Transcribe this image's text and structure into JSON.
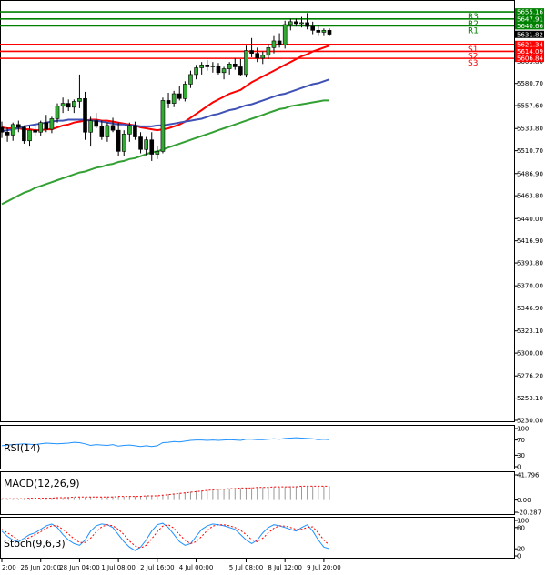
{
  "chart_data": [
    {
      "type": "candlestick",
      "name": "price",
      "ylim": [
        5230,
        5660
      ],
      "y_ticks": [
        "5655.16",
        "5647.91",
        "5640.66",
        "5631.82",
        "5621.34",
        "5614.09",
        "5606.84",
        "5603.80",
        "5580.70",
        "5557.60",
        "5533.80",
        "5510.70",
        "5486.90",
        "5463.80",
        "5440.00",
        "5416.90",
        "5393.80",
        "5370.00",
        "5346.90",
        "5323.10",
        "5300.00",
        "5276.20",
        "5253.10",
        "5230.00"
      ],
      "x_ticks": [
        "2:00",
        "26 Jun 20:00",
        "28 Jun 04:00",
        "1 Jul 08:00",
        "2 Jul 16:00",
        "4 Jul 00:00",
        "5 Jul 08:00",
        "8 Jul 12:00",
        "9 Jul 20:00"
      ],
      "current_price": 5631.82,
      "pivots": {
        "resistance": [
          {
            "label": "R3",
            "value": 5655.16,
            "color": "#008000"
          },
          {
            "label": "R2",
            "value": 5647.91,
            "color": "#008000"
          },
          {
            "label": "R1",
            "value": 5640.66,
            "color": "#008000"
          }
        ],
        "support": [
          {
            "label": "S1",
            "value": 5621.34,
            "color": "#ff0000"
          },
          {
            "label": "S2",
            "value": 5614.09,
            "color": "#ff0000"
          },
          {
            "label": "S3",
            "value": 5606.84,
            "color": "#ff0000"
          }
        ]
      },
      "candles": [
        [
          5535,
          5541,
          5524,
          5530
        ],
        [
          5530,
          5535,
          5520,
          5527
        ],
        [
          5527,
          5540,
          5521,
          5538
        ],
        [
          5538,
          5542,
          5530,
          5535
        ],
        [
          5535,
          5537,
          5518,
          5521
        ],
        [
          5521,
          5536,
          5515,
          5532
        ],
        [
          5532,
          5538,
          5526,
          5530
        ],
        [
          5530,
          5542,
          5526,
          5540
        ],
        [
          5540,
          5548,
          5530,
          5533
        ],
        [
          5533,
          5546,
          5529,
          5544
        ],
        [
          5544,
          5560,
          5540,
          5557
        ],
        [
          5557,
          5566,
          5550,
          5560
        ],
        [
          5560,
          5564,
          5552,
          5556
        ],
        [
          5556,
          5564,
          5550,
          5562
        ],
        [
          5562,
          5590,
          5555,
          5565
        ],
        [
          5565,
          5572,
          5522,
          5530
        ],
        [
          5530,
          5546,
          5515,
          5542
        ],
        [
          5542,
          5550,
          5534,
          5536
        ],
        [
          5536,
          5542,
          5522,
          5525
        ],
        [
          5525,
          5540,
          5520,
          5537
        ],
        [
          5537,
          5545,
          5530,
          5532
        ],
        [
          5532,
          5540,
          5505,
          5510
        ],
        [
          5510,
          5532,
          5505,
          5528
        ],
        [
          5528,
          5540,
          5520,
          5537
        ],
        [
          5537,
          5541,
          5522,
          5525
        ],
        [
          5525,
          5530,
          5508,
          5512
        ],
        [
          5512,
          5525,
          5506,
          5522
        ],
        [
          5522,
          5530,
          5500,
          5507
        ],
        [
          5507,
          5515,
          5502,
          5510
        ],
        [
          5510,
          5566,
          5508,
          5563
        ],
        [
          5563,
          5571,
          5555,
          5560
        ],
        [
          5560,
          5573,
          5556,
          5570
        ],
        [
          5570,
          5578,
          5563,
          5565
        ],
        [
          5565,
          5583,
          5562,
          5580
        ],
        [
          5580,
          5594,
          5576,
          5590
        ],
        [
          5590,
          5600,
          5585,
          5597
        ],
        [
          5597,
          5603,
          5590,
          5600
        ],
        [
          5600,
          5605,
          5594,
          5598
        ],
        [
          5598,
          5603,
          5592,
          5599
        ],
        [
          5599,
          5602,
          5590,
          5592
        ],
        [
          5592,
          5598,
          5585,
          5596
        ],
        [
          5596,
          5603,
          5590,
          5601
        ],
        [
          5601,
          5607,
          5595,
          5598
        ],
        [
          5598,
          5606,
          5589,
          5590
        ],
        [
          5590,
          5620,
          5587,
          5615
        ],
        [
          5615,
          5628,
          5608,
          5612
        ],
        [
          5612,
          5618,
          5603,
          5607
        ],
        [
          5607,
          5614,
          5601,
          5610
        ],
        [
          5610,
          5622,
          5606,
          5618
        ],
        [
          5618,
          5630,
          5612,
          5625
        ],
        [
          5625,
          5633,
          5618,
          5621
        ],
        [
          5621,
          5646,
          5617,
          5642
        ],
        [
          5642,
          5648,
          5636,
          5645
        ],
        [
          5645,
          5648,
          5640,
          5643
        ],
        [
          5643,
          5650,
          5639,
          5644
        ],
        [
          5644,
          5654,
          5637,
          5640
        ],
        [
          5640,
          5645,
          5632,
          5636
        ],
        [
          5636,
          5642,
          5630,
          5634
        ],
        [
          5634,
          5638,
          5630,
          5636
        ],
        [
          5636,
          5638,
          5630,
          5632
        ]
      ],
      "moving_averages": [
        {
          "name": "MA fast",
          "color": "#ff0000",
          "values": [
            5535,
            5534,
            5534,
            5534,
            5533,
            5533,
            5532,
            5532,
            5533,
            5533,
            5535,
            5537,
            5538,
            5540,
            5541,
            5542,
            5543,
            5543,
            5542,
            5542,
            5541,
            5540,
            5539,
            5538,
            5537,
            5535,
            5534,
            5533,
            5532,
            5533,
            5534,
            5536,
            5538,
            5541,
            5545,
            5549,
            5553,
            5557,
            5561,
            5564,
            5567,
            5570,
            5572,
            5574,
            5578,
            5582,
            5585,
            5588,
            5591,
            5594,
            5597,
            5600,
            5603,
            5606,
            5609,
            5611,
            5614,
            5616,
            5618,
            5620
          ]
        },
        {
          "name": "MA medium",
          "color": "#3f51b5",
          "values": [
            5531,
            5532,
            5533,
            5534,
            5536,
            5537,
            5538,
            5539,
            5540,
            5541,
            5542,
            5542,
            5543,
            5543,
            5543,
            5543,
            5542,
            5542,
            5541,
            5540,
            5539,
            5538,
            5538,
            5537,
            5537,
            5536,
            5536,
            5536,
            5537,
            5537,
            5538,
            5539,
            5540,
            5541,
            5542,
            5543,
            5544,
            5546,
            5548,
            5549,
            5551,
            5553,
            5554,
            5556,
            5558,
            5559,
            5561,
            5563,
            5565,
            5567,
            5569,
            5570,
            5572,
            5574,
            5576,
            5578,
            5580,
            5581,
            5583,
            5585
          ]
        },
        {
          "name": "MA slow",
          "color": "#33a033",
          "values": [
            5455,
            5458,
            5461,
            5464,
            5467,
            5469,
            5472,
            5474,
            5476,
            5478,
            5480,
            5482,
            5484,
            5486,
            5488,
            5489,
            5491,
            5493,
            5494,
            5496,
            5497,
            5499,
            5500,
            5502,
            5503,
            5505,
            5507,
            5509,
            5510,
            5512,
            5514,
            5516,
            5518,
            5520,
            5522,
            5524,
            5526,
            5528,
            5530,
            5532,
            5534,
            5536,
            5538,
            5540,
            5542,
            5544,
            5546,
            5548,
            5550,
            5552,
            5554,
            5555,
            5557,
            5558,
            5559,
            5560,
            5561,
            5562,
            5563,
            5563
          ]
        }
      ]
    },
    {
      "type": "line",
      "name": "RSI",
      "title": "RSI(14)",
      "ylim": [
        0,
        100
      ],
      "y_ticks": [
        "100",
        "70",
        "30",
        "0"
      ],
      "values": [
        55,
        57,
        58,
        59,
        60,
        59,
        58,
        60,
        62,
        61,
        60,
        61,
        62,
        64,
        63,
        60,
        56,
        58,
        57,
        56,
        58,
        54,
        56,
        57,
        55,
        53,
        55,
        53,
        55,
        63,
        64,
        66,
        65,
        67,
        69,
        70,
        70,
        69,
        70,
        69,
        70,
        71,
        70,
        69,
        72,
        72,
        71,
        71,
        72,
        73,
        72,
        74,
        75,
        76,
        75,
        74,
        73,
        71,
        72,
        71
      ],
      "color": "#1e90ff"
    },
    {
      "type": "bar",
      "name": "MACD",
      "title": "MACD(12,26,9)",
      "ylim": [
        -20.287,
        41.796
      ],
      "y_ticks": [
        "41.796",
        "0.00",
        "-20.287"
      ],
      "values": [
        2,
        2,
        2,
        2,
        3,
        3,
        3,
        3,
        3,
        4,
        4,
        4,
        5,
        5,
        5,
        5,
        5,
        5,
        5,
        5,
        6,
        6,
        6,
        6,
        6,
        7,
        7,
        7,
        8,
        9,
        10,
        11,
        12,
        13,
        14,
        15,
        16,
        17,
        18,
        18,
        19,
        19,
        20,
        20,
        20,
        21,
        21,
        21,
        22,
        22,
        22,
        22,
        23,
        23,
        23,
        23,
        23,
        23,
        23,
        23
      ],
      "signal": [
        2,
        2,
        2,
        2,
        2,
        3,
        3,
        3,
        3,
        3,
        4,
        4,
        4,
        5,
        5,
        5,
        5,
        5,
        5,
        5,
        5,
        6,
        6,
        6,
        6,
        6,
        7,
        7,
        7,
        8,
        9,
        10,
        11,
        12,
        13,
        14,
        15,
        16,
        17,
        18,
        18,
        19,
        19,
        20,
        20,
        20,
        21,
        21,
        21,
        22,
        22,
        22,
        22,
        22,
        23,
        23,
        23,
        23,
        23,
        23
      ]
    },
    {
      "type": "line",
      "name": "Stochastic",
      "title": "Stoch(9,6,3)",
      "ylim": [
        0,
        100
      ],
      "y_ticks": [
        "100",
        "80",
        "20",
        "0"
      ],
      "k_values": [
        70,
        55,
        45,
        40,
        50,
        60,
        65,
        75,
        85,
        90,
        80,
        60,
        45,
        35,
        30,
        45,
        70,
        85,
        90,
        88,
        80,
        60,
        40,
        25,
        15,
        25,
        45,
        70,
        88,
        92,
        80,
        60,
        40,
        30,
        35,
        55,
        75,
        85,
        90,
        88,
        85,
        80,
        75,
        60,
        45,
        35,
        45,
        65,
        80,
        88,
        85,
        80,
        75,
        70,
        80,
        88,
        70,
        45,
        25,
        20
      ],
      "d_values": [
        75,
        65,
        55,
        45,
        45,
        52,
        60,
        68,
        78,
        85,
        85,
        75,
        62,
        48,
        38,
        38,
        50,
        68,
        82,
        88,
        85,
        75,
        60,
        42,
        28,
        22,
        30,
        48,
        68,
        84,
        88,
        78,
        60,
        44,
        35,
        40,
        55,
        72,
        84,
        88,
        88,
        85,
        80,
        72,
        60,
        46,
        40,
        50,
        65,
        78,
        85,
        84,
        80,
        75,
        75,
        80,
        82,
        65,
        45,
        30
      ],
      "k_color": "#1e90ff",
      "d_color": "#ff0000"
    }
  ]
}
